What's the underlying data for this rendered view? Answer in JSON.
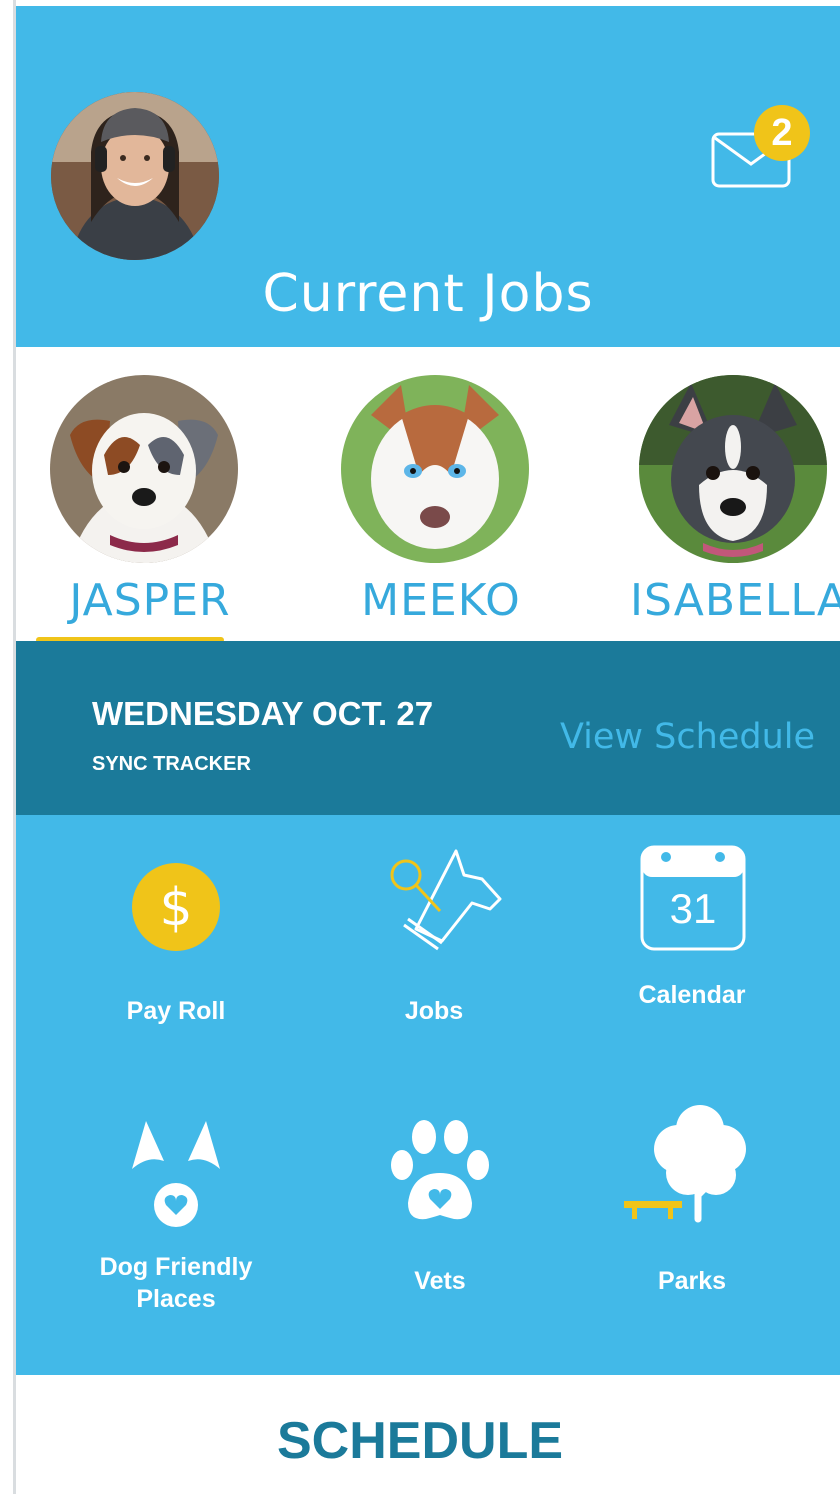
{
  "header": {
    "title": "Current Jobs",
    "avatar_icon": "user-avatar",
    "mail_icon": "envelope-icon",
    "unread_count": "2"
  },
  "dogs": [
    {
      "name": "JASPER",
      "selected": true
    },
    {
      "name": "MEEKO",
      "selected": false
    },
    {
      "name": "ISABELLA",
      "selected": false
    }
  ],
  "date_bar": {
    "date": "WEDNESDAY OCT. 27",
    "tracker": "SYNC TRACKER",
    "view_schedule": "View Schedule"
  },
  "menu": {
    "payroll": {
      "label": "Pay Roll",
      "icon": "dollar-coin-icon"
    },
    "jobs": {
      "label": "Jobs",
      "icon": "dog-head-leash-icon"
    },
    "calendar": {
      "label": "Calendar",
      "icon": "calendar-icon",
      "day": "31"
    },
    "dog_friendly": {
      "label_line1": "Dog Friendly",
      "label_line2": "Places",
      "icon": "dog-ears-heart-icon"
    },
    "vets": {
      "label": "Vets",
      "icon": "paw-heart-icon"
    },
    "parks": {
      "label": "Parks",
      "icon": "tree-bench-icon"
    }
  },
  "bottom": {
    "title": "SCHEDULE"
  },
  "colors": {
    "primary": "#42b9e8",
    "dark": "#1b7a9a",
    "accent": "#f0c419",
    "white": "#ffffff"
  }
}
